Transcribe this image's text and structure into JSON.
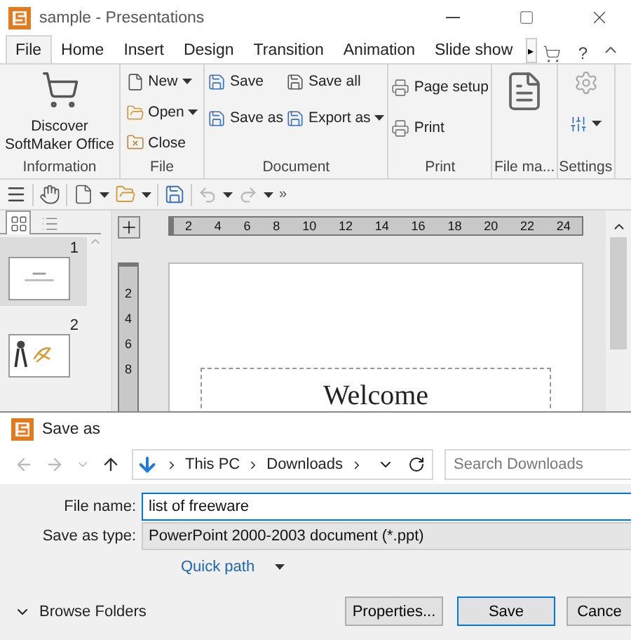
{
  "window": {
    "title": "sample - Presentations"
  },
  "ribbon_tabs": [
    {
      "label": "File",
      "selected": true
    },
    {
      "label": "Home",
      "selected": false
    },
    {
      "label": "Insert",
      "selected": false
    },
    {
      "label": "Design",
      "selected": false
    },
    {
      "label": "Transition",
      "selected": false
    },
    {
      "label": "Animation",
      "selected": false
    },
    {
      "label": "Slide show",
      "selected": false
    }
  ],
  "tab_overflow": "▸",
  "help": "?",
  "ribbon_groups": [
    {
      "label": "Information",
      "kind": "discover",
      "items": [
        {
          "label": "Discover SoftMaker Office"
        }
      ]
    },
    {
      "label": "File",
      "kind": "list",
      "items": [
        {
          "label": "New",
          "dropdown": true
        },
        {
          "label": "Open",
          "dropdown": true
        },
        {
          "label": "Close",
          "dropdown": false
        }
      ]
    },
    {
      "label": "Document",
      "kind": "grid",
      "items": [
        {
          "label": "Save",
          "dropdown": false
        },
        {
          "label": "Save all",
          "dropdown": false
        },
        {
          "label": "Save as",
          "dropdown": false
        },
        {
          "label": "Export as",
          "dropdown": true
        }
      ]
    },
    {
      "label": "Print",
      "kind": "list",
      "items": [
        {
          "label": "Page setup",
          "dropdown": false
        },
        {
          "label": "Print",
          "dropdown": false
        }
      ]
    },
    {
      "label": "File ma...",
      "kind": "big"
    },
    {
      "label": "Settings",
      "kind": "settings"
    }
  ],
  "toolbar_overflow": "»",
  "slides": [
    {
      "number": "1",
      "selected": true,
      "kind": "title"
    },
    {
      "number": "2",
      "selected": false,
      "kind": "figure"
    }
  ],
  "ruler_h": [
    "2",
    "4",
    "6",
    "8",
    "10",
    "12",
    "14",
    "16",
    "18",
    "20",
    "22",
    "24"
  ],
  "ruler_v": [
    "2",
    "4",
    "6",
    "8"
  ],
  "slide": {
    "title": "Welcome"
  },
  "dialog": {
    "title": "Save as",
    "breadcrumb": [
      "This PC",
      "Downloads"
    ],
    "search_placeholder": "Search Downloads",
    "fields": [
      {
        "label": "File name:",
        "value": "list of freeware",
        "kind": "input"
      },
      {
        "label": "Save as type:",
        "value": "PowerPoint 2000-2003 document (*.ppt)",
        "kind": "select"
      }
    ],
    "quick_path": "Quick path",
    "browse": "Browse Folders",
    "buttons": [
      {
        "label": "Properties...",
        "default": false
      },
      {
        "label": "Save",
        "default": true
      },
      {
        "label": "Cance",
        "default": false
      }
    ]
  }
}
